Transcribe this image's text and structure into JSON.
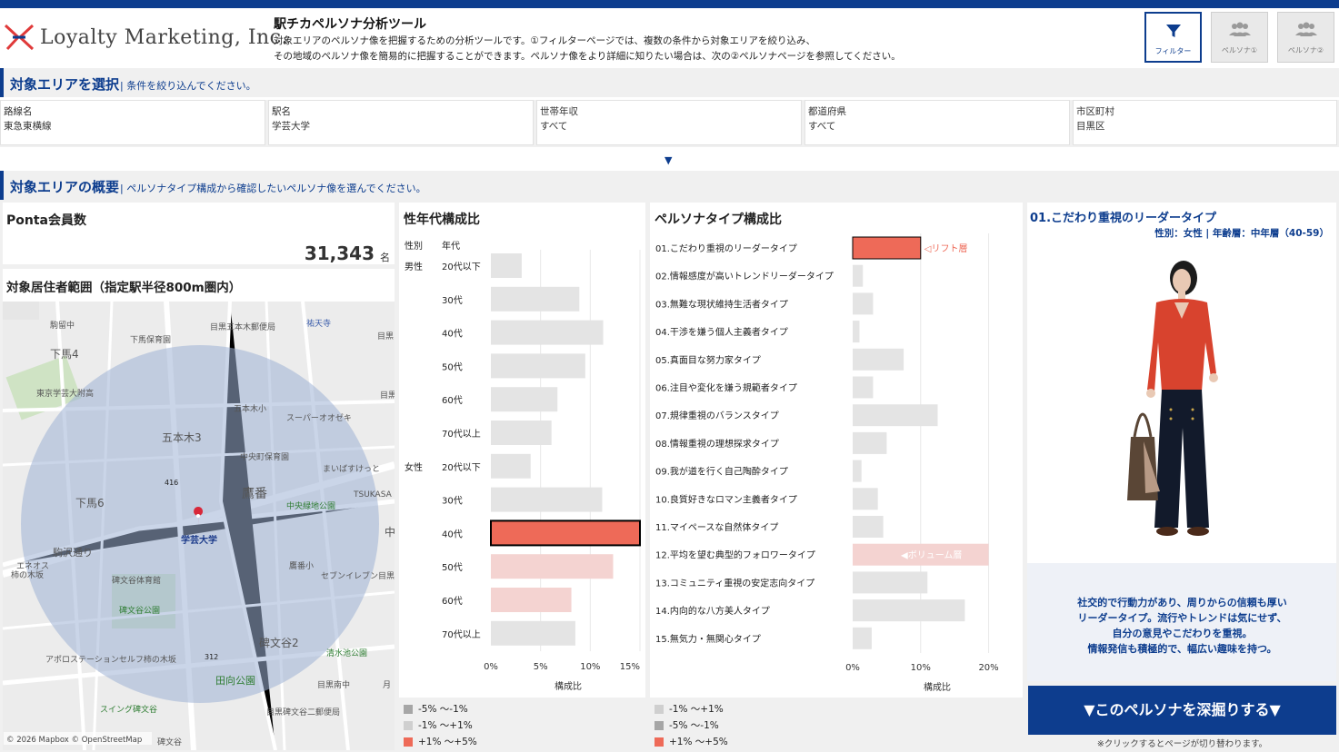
{
  "brand": {
    "logo_text": "Loyalty Marketing, Inc."
  },
  "header": {
    "title": "駅チカペルソナ分析ツール",
    "desc_line1": "対象エリアのペルソナ像を把握するための分析ツールです。①フィルターページでは、複数の条件から対象エリアを絞り込み、",
    "desc_line2": "その地域のペルソナ像を簡易的に把握することができます。ペルソナ像をより詳細に知りたい場合は、次の②ペルソナページを参照してください。"
  },
  "nav": [
    {
      "label": "フィルター",
      "icon": "filter-icon",
      "active": true
    },
    {
      "label": "ペルソナ①",
      "icon": "people-icon",
      "active": false
    },
    {
      "label": "ペルソナ②",
      "icon": "people-icon",
      "active": false
    }
  ],
  "section1": {
    "title": "対象エリアを選択",
    "subtitle": "| 条件を絞り込んでください。"
  },
  "filters": [
    {
      "label": "路線名",
      "value": "東急東横線"
    },
    {
      "label": "駅名",
      "value": "学芸大学"
    },
    {
      "label": "世帯年収",
      "value": "すべて"
    },
    {
      "label": "都道府県",
      "value": "すべて"
    },
    {
      "label": "市区町村",
      "value": "目黒区"
    }
  ],
  "expand_glyph": "▼",
  "section2": {
    "title": "対象エリアの概要",
    "subtitle": "| ペルソナタイプ構成から確認したいペルソナ像を選んでください。"
  },
  "ponta": {
    "title": "Ponta会員数",
    "value": "31,343",
    "unit": "名"
  },
  "map": {
    "title": "対象居住者範囲（指定駅半径800m圏内）",
    "station": "学芸大学",
    "attribution": "© 2026 Mapbox © OpenStreetMap",
    "labels": [
      "駒留中",
      "下馬保育園",
      "目黒五本木郵便局",
      "祐天寺",
      "目黒",
      "下馬4",
      "東京学芸大附高",
      "五本木小",
      "スーパーオオゼキ",
      "目黒中央",
      "五本木3",
      "中央町保育園",
      "まいばすけっと",
      "TSUKASA",
      "416",
      "鷹番",
      "中央緑地公園",
      "下馬6",
      "中",
      "駒沢通り",
      "エネオス",
      "柿の木坂",
      "碑文谷体育館",
      "鷹番小",
      "セブンイレブン目黒中央1丁目店",
      "碑文谷公園",
      "碑文谷2",
      "清水池公園",
      "アポロステーションセルフ柿の木坂",
      "312",
      "田向公園",
      "目黒南中",
      "月",
      "スイング碑文谷",
      "目黒碑文谷二郵便局",
      "五本木3",
      "碑文谷"
    ]
  },
  "age_chart": {
    "title": "性年代構成比",
    "col_gender": "性別",
    "col_age": "年代",
    "xlabel": "構成比",
    "legend": [
      "-5% 〜-1%",
      "-1% 〜+1%",
      "+1% 〜+5%"
    ]
  },
  "persona_chart": {
    "title": "ペルソナタイプ構成比",
    "xlabel": "構成比",
    "annot_lift": "◁リフト層",
    "annot_volume": "◀ボリューム層",
    "legend": [
      "-1% 〜+1%",
      "-5% 〜-1%",
      "+1% 〜+5%"
    ]
  },
  "chart_data": [
    {
      "type": "bar",
      "title": "性年代構成比",
      "xlabel": "構成比",
      "xlim": [
        0,
        15
      ],
      "xticks": [
        "0%",
        "5%",
        "10%",
        "15%"
      ],
      "groups": [
        "男性",
        "女性"
      ],
      "categories": [
        "20代以下",
        "30代",
        "40代",
        "50代",
        "60代",
        "70代以上",
        "20代以下",
        "30代",
        "40代",
        "50代",
        "60代",
        "70代以上"
      ],
      "values": [
        3.1,
        8.9,
        11.3,
        9.5,
        6.7,
        6.1,
        4.0,
        11.2,
        15.0,
        12.3,
        8.1,
        8.5
      ],
      "selected_index": 8,
      "colors": [
        "#e4e4e4",
        "#e4e4e4",
        "#e4e4e4",
        "#e4e4e4",
        "#e4e4e4",
        "#e4e4e4",
        "#e4e4e4",
        "#e4e4e4",
        "#ee6a58",
        "#f4d3d1",
        "#f4d3d1",
        "#e4e4e4"
      ]
    },
    {
      "type": "bar",
      "title": "ペルソナタイプ構成比",
      "xlabel": "構成比",
      "xlim": [
        0,
        23
      ],
      "xticks": [
        "0%",
        "10%",
        "20%"
      ],
      "categories": [
        "01.こだわり重視のリーダータイプ",
        "02.情報感度が高いトレンドリーダータイプ",
        "03.無難な現状維持生活者タイプ",
        "04.干渉を嫌う個人主義者タイプ",
        "05.真面目な努力家タイプ",
        "06.注目や変化を嫌う規範者タイプ",
        "07.規律重視のバランスタイプ",
        "08.情報重視の理想探求タイプ",
        "09.我が道を行く自己陶酔タイプ",
        "10.良質好きなロマン主義者タイプ",
        "11.マイペースな自然体タイプ",
        "12.平均を望む典型的フォロワータイプ",
        "13.コミュニティ重視の安定志向タイプ",
        "14.内向的な八方美人タイプ",
        "15.無気力・無関心タイプ"
      ],
      "values": [
        10.0,
        1.5,
        3.0,
        1.0,
        7.5,
        3.0,
        12.5,
        5.0,
        1.3,
        3.7,
        4.5,
        20.0,
        11.0,
        16.5,
        2.8
      ],
      "selected_index": 0,
      "colors": [
        "#ee6a58",
        "#e4e4e4",
        "#e4e4e4",
        "#e4e4e4",
        "#e4e4e4",
        "#e4e4e4",
        "#e4e4e4",
        "#e4e4e4",
        "#e4e4e4",
        "#e4e4e4",
        "#e4e4e4",
        "#f4d3d1",
        "#e4e4e4",
        "#e4e4e4",
        "#e4e4e4"
      ]
    }
  ],
  "persona": {
    "title": "01.こだわり重視のリーダータイプ",
    "meta": "性別：女性 | 年齢層：中年層（40-59）",
    "desc": [
      "社交的で行動力があり、周りからの信頼も厚い",
      "リーダータイプ。流行やトレンドは気にせず、",
      "自分の意見やこだわりを重視。",
      "情報発信も積極的で、幅広い趣味を持つ。"
    ],
    "cta": "▼このペルソナを深掘りする▼",
    "cta_note": "※クリックするとページが切り替わります。"
  },
  "colors": {
    "brand": "#0d3d8e",
    "highlight": "#ee6a58",
    "light_highlight": "#f4d3d1",
    "neutral_bar": "#e4e4e4"
  }
}
